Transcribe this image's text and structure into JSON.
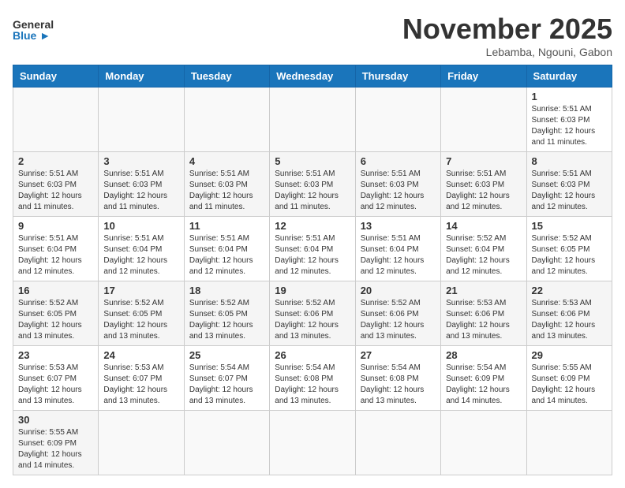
{
  "header": {
    "logo_general": "General",
    "logo_blue": "Blue",
    "month_title": "November 2025",
    "subtitle": "Lebamba, Ngouni, Gabon"
  },
  "weekdays": [
    "Sunday",
    "Monday",
    "Tuesday",
    "Wednesday",
    "Thursday",
    "Friday",
    "Saturday"
  ],
  "days": {
    "d1": {
      "num": "1",
      "sunrise": "5:51 AM",
      "sunset": "6:03 PM",
      "daylight": "12 hours and 11 minutes."
    },
    "d2": {
      "num": "2",
      "sunrise": "5:51 AM",
      "sunset": "6:03 PM",
      "daylight": "12 hours and 11 minutes."
    },
    "d3": {
      "num": "3",
      "sunrise": "5:51 AM",
      "sunset": "6:03 PM",
      "daylight": "12 hours and 11 minutes."
    },
    "d4": {
      "num": "4",
      "sunrise": "5:51 AM",
      "sunset": "6:03 PM",
      "daylight": "12 hours and 11 minutes."
    },
    "d5": {
      "num": "5",
      "sunrise": "5:51 AM",
      "sunset": "6:03 PM",
      "daylight": "12 hours and 11 minutes."
    },
    "d6": {
      "num": "6",
      "sunrise": "5:51 AM",
      "sunset": "6:03 PM",
      "daylight": "12 hours and 12 minutes."
    },
    "d7": {
      "num": "7",
      "sunrise": "5:51 AM",
      "sunset": "6:03 PM",
      "daylight": "12 hours and 12 minutes."
    },
    "d8": {
      "num": "8",
      "sunrise": "5:51 AM",
      "sunset": "6:03 PM",
      "daylight": "12 hours and 12 minutes."
    },
    "d9": {
      "num": "9",
      "sunrise": "5:51 AM",
      "sunset": "6:04 PM",
      "daylight": "12 hours and 12 minutes."
    },
    "d10": {
      "num": "10",
      "sunrise": "5:51 AM",
      "sunset": "6:04 PM",
      "daylight": "12 hours and 12 minutes."
    },
    "d11": {
      "num": "11",
      "sunrise": "5:51 AM",
      "sunset": "6:04 PM",
      "daylight": "12 hours and 12 minutes."
    },
    "d12": {
      "num": "12",
      "sunrise": "5:51 AM",
      "sunset": "6:04 PM",
      "daylight": "12 hours and 12 minutes."
    },
    "d13": {
      "num": "13",
      "sunrise": "5:51 AM",
      "sunset": "6:04 PM",
      "daylight": "12 hours and 12 minutes."
    },
    "d14": {
      "num": "14",
      "sunrise": "5:52 AM",
      "sunset": "6:04 PM",
      "daylight": "12 hours and 12 minutes."
    },
    "d15": {
      "num": "15",
      "sunrise": "5:52 AM",
      "sunset": "6:05 PM",
      "daylight": "12 hours and 12 minutes."
    },
    "d16": {
      "num": "16",
      "sunrise": "5:52 AM",
      "sunset": "6:05 PM",
      "daylight": "12 hours and 13 minutes."
    },
    "d17": {
      "num": "17",
      "sunrise": "5:52 AM",
      "sunset": "6:05 PM",
      "daylight": "12 hours and 13 minutes."
    },
    "d18": {
      "num": "18",
      "sunrise": "5:52 AM",
      "sunset": "6:05 PM",
      "daylight": "12 hours and 13 minutes."
    },
    "d19": {
      "num": "19",
      "sunrise": "5:52 AM",
      "sunset": "6:06 PM",
      "daylight": "12 hours and 13 minutes."
    },
    "d20": {
      "num": "20",
      "sunrise": "5:52 AM",
      "sunset": "6:06 PM",
      "daylight": "12 hours and 13 minutes."
    },
    "d21": {
      "num": "21",
      "sunrise": "5:53 AM",
      "sunset": "6:06 PM",
      "daylight": "12 hours and 13 minutes."
    },
    "d22": {
      "num": "22",
      "sunrise": "5:53 AM",
      "sunset": "6:06 PM",
      "daylight": "12 hours and 13 minutes."
    },
    "d23": {
      "num": "23",
      "sunrise": "5:53 AM",
      "sunset": "6:07 PM",
      "daylight": "12 hours and 13 minutes."
    },
    "d24": {
      "num": "24",
      "sunrise": "5:53 AM",
      "sunset": "6:07 PM",
      "daylight": "12 hours and 13 minutes."
    },
    "d25": {
      "num": "25",
      "sunrise": "5:54 AM",
      "sunset": "6:07 PM",
      "daylight": "12 hours and 13 minutes."
    },
    "d26": {
      "num": "26",
      "sunrise": "5:54 AM",
      "sunset": "6:08 PM",
      "daylight": "12 hours and 13 minutes."
    },
    "d27": {
      "num": "27",
      "sunrise": "5:54 AM",
      "sunset": "6:08 PM",
      "daylight": "12 hours and 13 minutes."
    },
    "d28": {
      "num": "28",
      "sunrise": "5:54 AM",
      "sunset": "6:09 PM",
      "daylight": "12 hours and 14 minutes."
    },
    "d29": {
      "num": "29",
      "sunrise": "5:55 AM",
      "sunset": "6:09 PM",
      "daylight": "12 hours and 14 minutes."
    },
    "d30": {
      "num": "30",
      "sunrise": "5:55 AM",
      "sunset": "6:09 PM",
      "daylight": "12 hours and 14 minutes."
    }
  },
  "labels": {
    "sunrise": "Sunrise:",
    "sunset": "Sunset:",
    "daylight": "Daylight:"
  }
}
